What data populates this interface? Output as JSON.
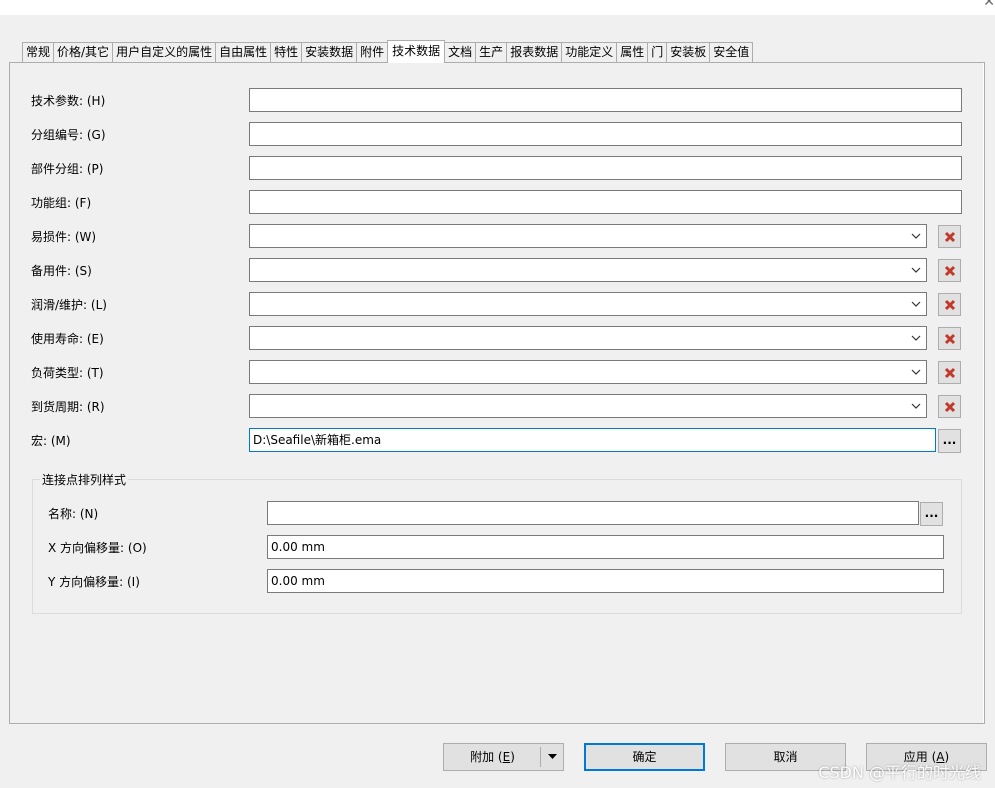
{
  "window": {
    "close_glyph": "✕"
  },
  "tabs": [
    {
      "label": "常规"
    },
    {
      "label": "价格/其它"
    },
    {
      "label": "用户自定义的属性"
    },
    {
      "label": "自由属性"
    },
    {
      "label": "特性"
    },
    {
      "label": "安装数据"
    },
    {
      "label": "附件"
    },
    {
      "label": "技术数据",
      "active": true
    },
    {
      "label": "文档"
    },
    {
      "label": "生产"
    },
    {
      "label": "报表数据"
    },
    {
      "label": "功能定义"
    },
    {
      "label": "属性"
    },
    {
      "label": "门"
    },
    {
      "label": "安装板"
    },
    {
      "label": "安全值"
    }
  ],
  "fields": {
    "tech_params": {
      "label": "技术参数: (H)",
      "value": ""
    },
    "group_number": {
      "label": "分组编号: (G)",
      "value": ""
    },
    "part_group": {
      "label": "部件分组: (P)",
      "value": ""
    },
    "function_group": {
      "label": "功能组: (F)",
      "value": ""
    },
    "wear_part": {
      "label": "易损件: (W)",
      "value": ""
    },
    "spare_part": {
      "label": "备用件: (S)",
      "value": ""
    },
    "lubrication": {
      "label": "润滑/维护: (L)",
      "value": ""
    },
    "service_life": {
      "label": "使用寿命: (E)",
      "value": ""
    },
    "load_type": {
      "label": "负荷类型: (T)",
      "value": ""
    },
    "delivery_period": {
      "label": "到货周期: (R)",
      "value": ""
    },
    "macro": {
      "label": "宏: (M)",
      "value": "D:\\Seafile\\新箱柜.ema"
    }
  },
  "connection_style": {
    "title": "连接点排列样式",
    "name": {
      "label": "名称: (N)",
      "value": ""
    },
    "x_offset": {
      "label": "X 方向偏移量: (O)",
      "value": "0.00 mm"
    },
    "y_offset": {
      "label": "Y 方向偏移量: (I)",
      "value": "0.00 mm"
    }
  },
  "buttons": {
    "browse": "...",
    "append": {
      "label": "附加",
      "mnemonic": "E"
    },
    "ok": "确定",
    "cancel": "取消",
    "apply": {
      "label": "应用",
      "mnemonic": "A"
    }
  },
  "watermark": "CSDN @平行的时光线",
  "colors": {
    "delete_icon": "#c0392b",
    "focus_border": "#0078d7",
    "background": "#f0f0f0"
  },
  "icons": {
    "dropdown": "chevron-down-icon",
    "delete": "red-x-icon",
    "split_arrow": "triangle-down-icon"
  }
}
